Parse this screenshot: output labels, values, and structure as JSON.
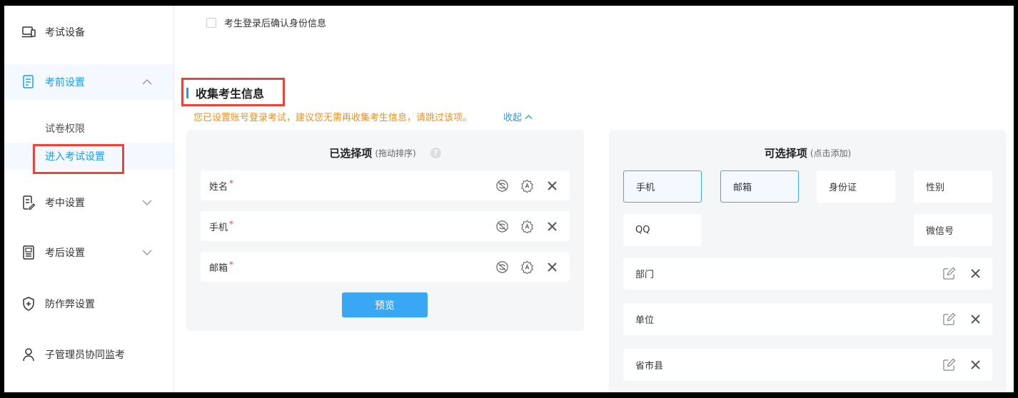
{
  "sidebar": {
    "items": [
      {
        "label": "考试设备",
        "icon": "laptop-icon"
      },
      {
        "label": "考前设置",
        "icon": "document-icon"
      },
      {
        "label": "考中设置",
        "icon": "edit-document-icon"
      },
      {
        "label": "考后设置",
        "icon": "report-icon"
      },
      {
        "label": "防作弊设置",
        "icon": "shield-plus-icon"
      },
      {
        "label": "子管理员协同监考",
        "icon": "user-icon"
      }
    ],
    "sub_items": [
      {
        "label": "试卷权限"
      },
      {
        "label": "进入考试设置"
      }
    ]
  },
  "main": {
    "confirm_checkbox_label": "考生登录后确认身份信息",
    "section_title": "收集考生信息",
    "notice": "您已设置账号登录考试，建议您无需再收集考生信息，请跳过该项。",
    "collapse_label": "收起",
    "selected_panel": {
      "title": "已选择项",
      "hint": "(拖动排序)",
      "help": "?",
      "fields": [
        {
          "label": "姓名",
          "required": "*"
        },
        {
          "label": "手机",
          "required": "*"
        },
        {
          "label": "邮箱",
          "required": "*"
        }
      ],
      "preview_label": "预览"
    },
    "optional_panel": {
      "title": "可选择项",
      "hint": "(点击添加)",
      "options": [
        {
          "label": "手机"
        },
        {
          "label": "邮箱"
        },
        {
          "label": "身份证"
        },
        {
          "label": "性别"
        },
        {
          "label": "QQ"
        },
        {
          "label": "微信号"
        }
      ],
      "custom_fields": [
        {
          "label": "部门"
        },
        {
          "label": "单位"
        },
        {
          "label": "省市县"
        }
      ]
    }
  },
  "colors": {
    "accent": "#1e9cf0",
    "warning": "#f0901e",
    "highlight_border": "#e8453c",
    "button": "#3aa7f5"
  }
}
